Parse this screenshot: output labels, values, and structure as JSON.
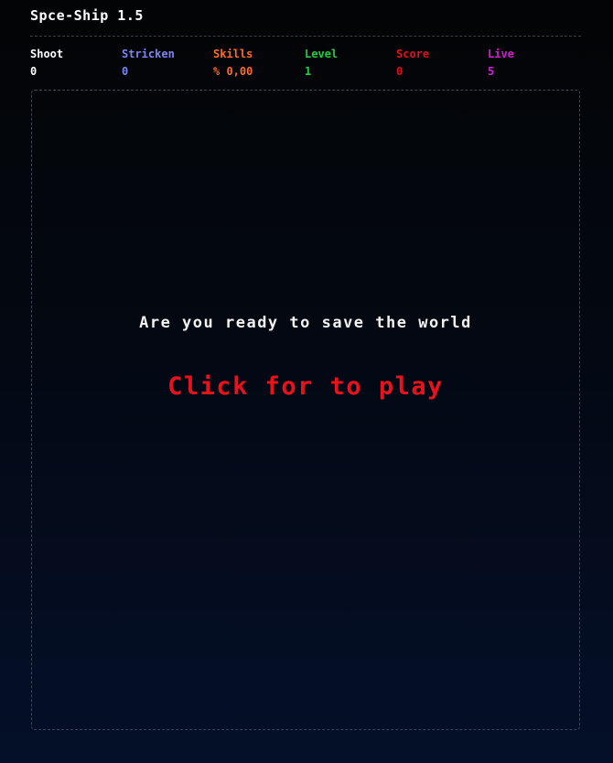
{
  "app": {
    "title": "Spce-Ship 1.5"
  },
  "stats": [
    {
      "label": "Shoot",
      "value": "0",
      "color": "#ffffff"
    },
    {
      "label": "Stricken",
      "value": "0",
      "color": "#7b86f0"
    },
    {
      "label": "Skills",
      "value": "% 0,00",
      "color": "#ff6a2a"
    },
    {
      "label": "Level",
      "value": "1",
      "color": "#1ed040"
    },
    {
      "label": "Score",
      "value": "0",
      "color": "#e0101e"
    },
    {
      "label": "Live",
      "value": "5",
      "color": "#cc22cc"
    }
  ],
  "game": {
    "ready_text": "Are you ready to save the world",
    "play_text": "Click for to play",
    "play_color": "#e8121c"
  }
}
